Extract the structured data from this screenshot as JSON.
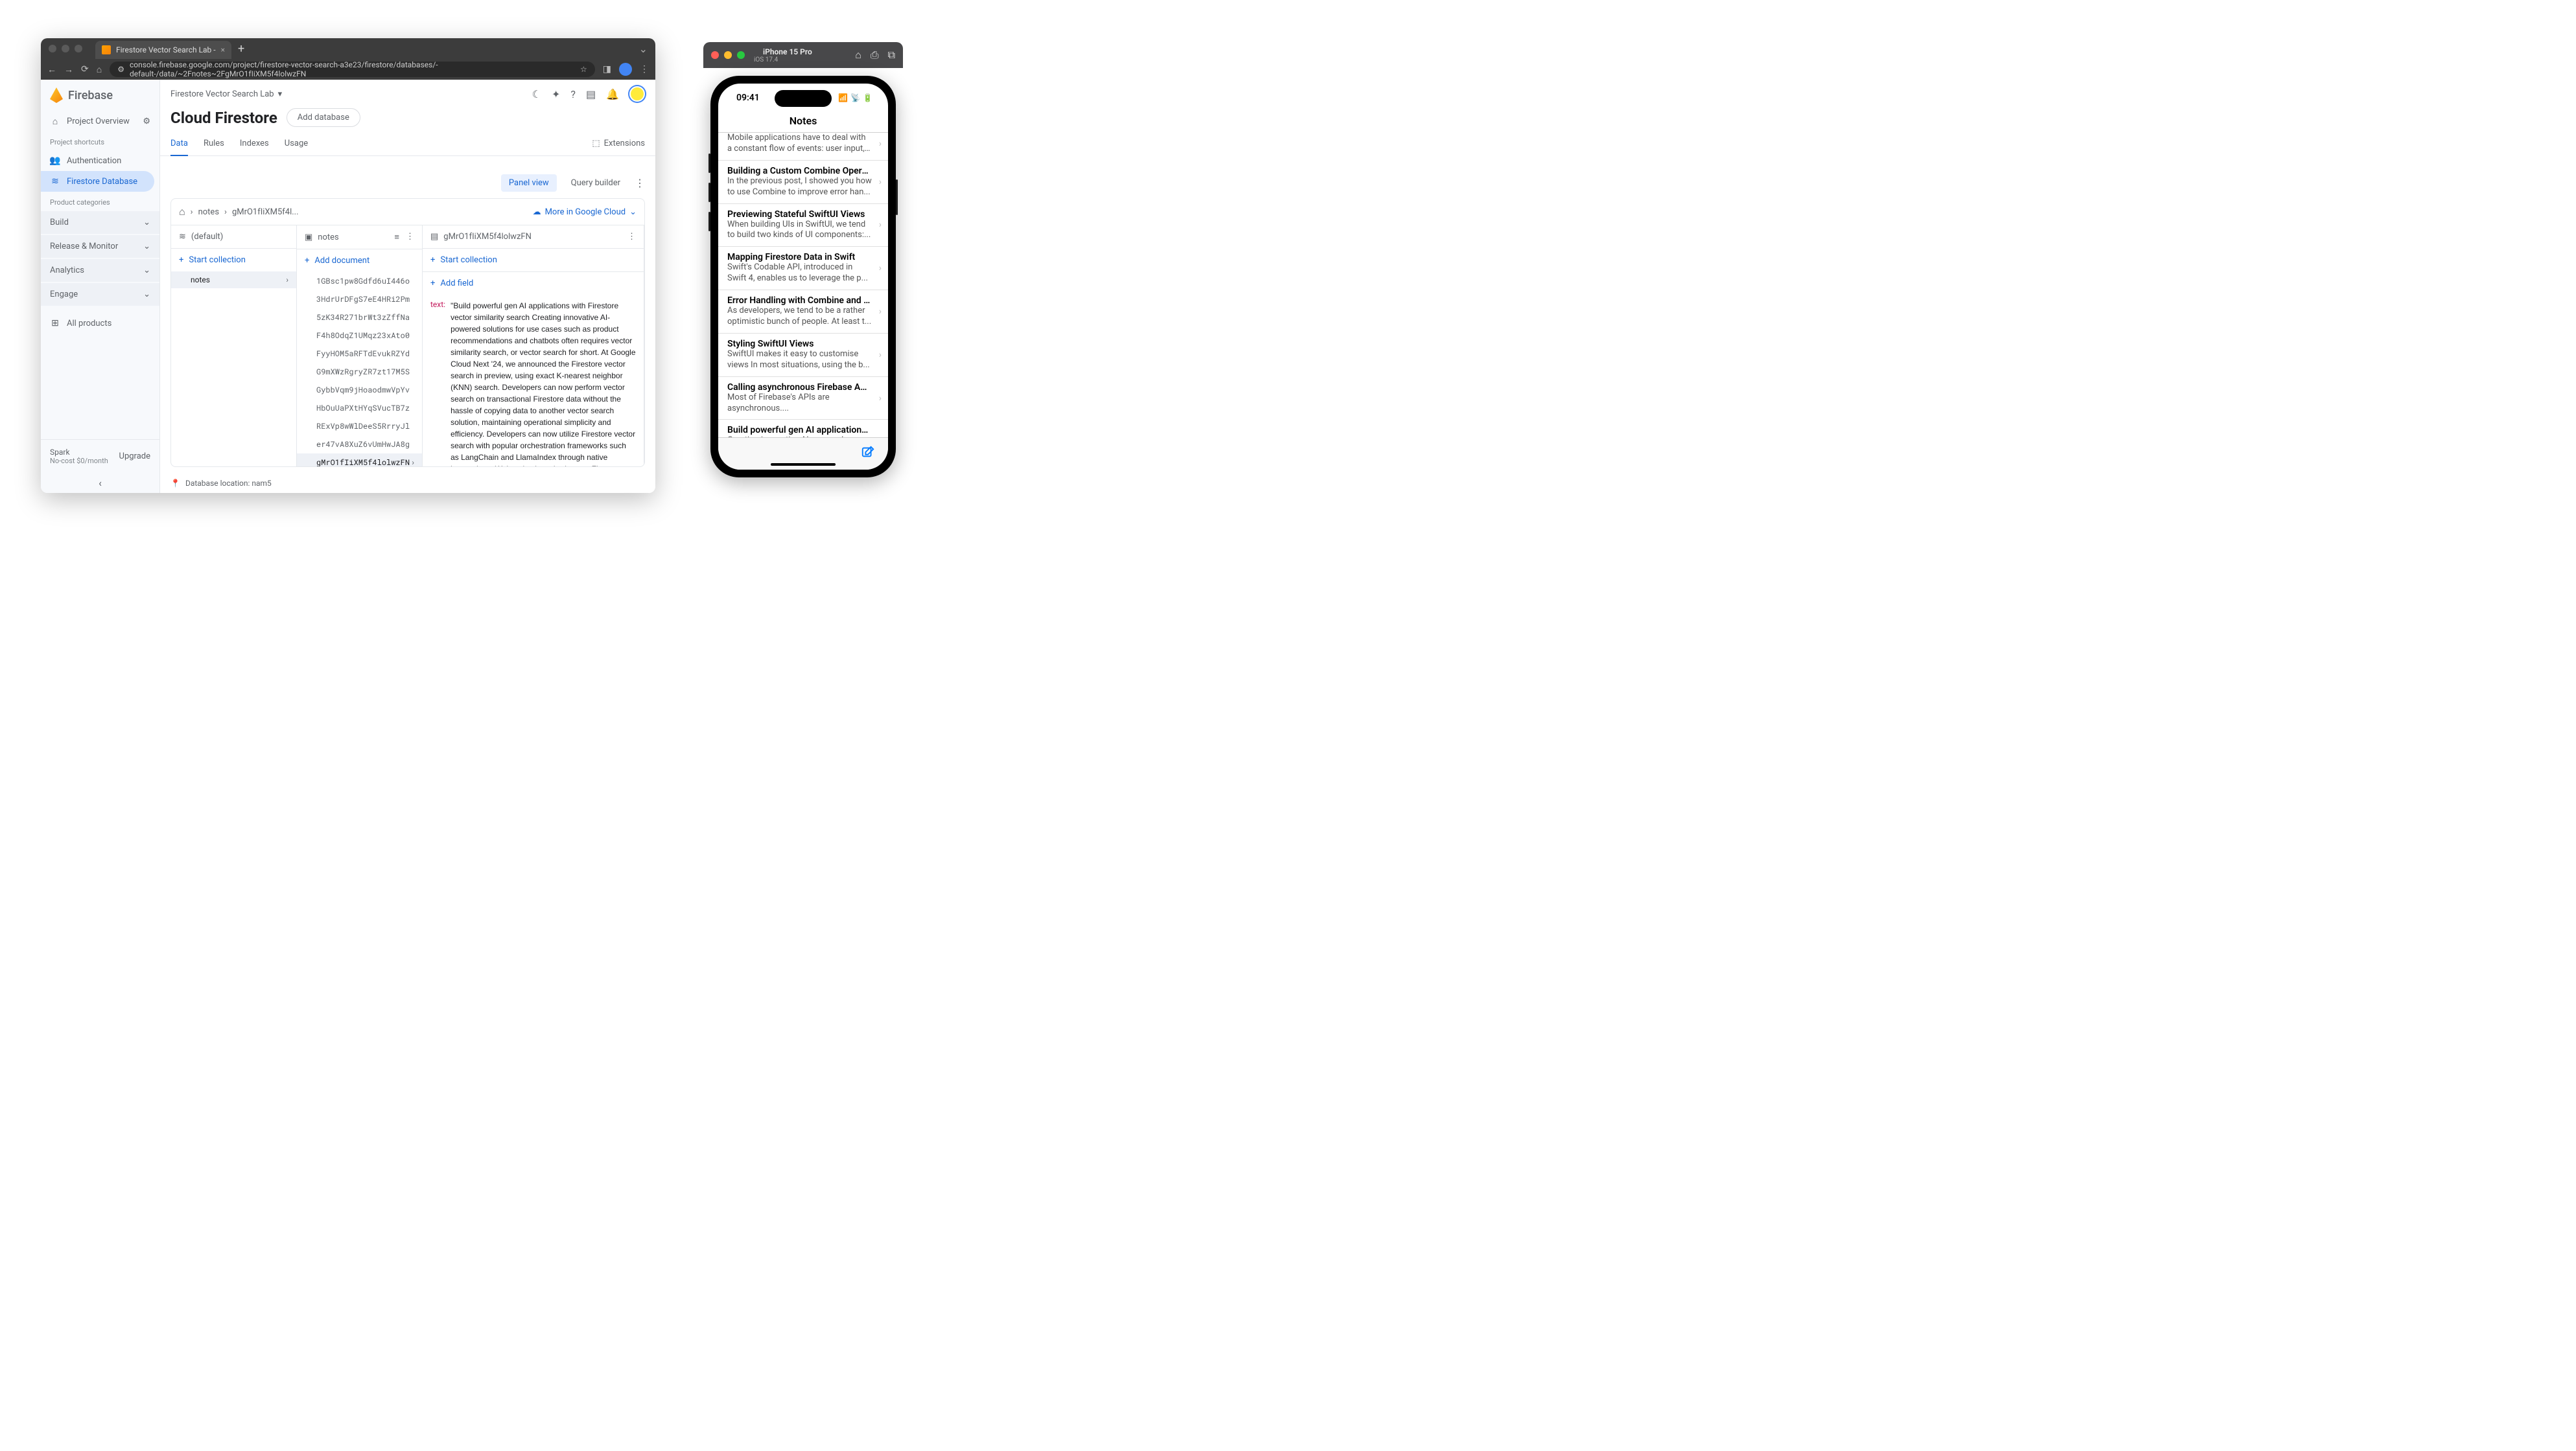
{
  "browser": {
    "tab_title": "Firestore Vector Search Lab - ",
    "url": "console.firebase.google.com/project/firestore-vector-search-a3e23/firestore/databases/-default-/data/~2Fnotes~2FgMrO1fIiXM5f4lolwzFN"
  },
  "firebase": {
    "logo": "Firebase",
    "overview": "Project Overview",
    "shortcuts_label": "Project shortcuts",
    "shortcuts": [
      "Authentication",
      "Firestore Database"
    ],
    "categories_label": "Product categories",
    "categories": [
      "Build",
      "Release & Monitor",
      "Analytics",
      "Engage"
    ],
    "all_products": "All products",
    "spark": "Spark",
    "spark_sub": "No-cost $0/month",
    "upgrade": "Upgrade",
    "project": "Firestore Vector Search Lab",
    "title": "Cloud Firestore",
    "add_db": "Add database",
    "tabs": [
      "Data",
      "Rules",
      "Indexes",
      "Usage"
    ],
    "extensions": "Extensions",
    "panel_view": "Panel view",
    "query_builder": "Query builder",
    "breadcrumb": {
      "coll": "notes",
      "doc": "gMrO1fIiXM5f4l..."
    },
    "more_cloud": "More in Google Cloud",
    "p1_head": "(default)",
    "p2_head": "notes",
    "p3_head": "gMrO1fIiXM5f4lolwzFN",
    "start_collection": "Start collection",
    "add_document": "Add document",
    "add_field": "Add field",
    "collections": [
      "notes"
    ],
    "docs": [
      "1GBsc1pw8Gdfd6uI446o",
      "3HdrUrDFgS7eE4HRi2Pm",
      "5zK34R271brWt3zZffNa",
      "F4h8OdqZ1UMqz23xAto0",
      "FyyHOM5aRFTdEvukRZYd",
      "G9mXWzRgryZR7zt17M5S",
      "GybbVqm9jHoaodmwVpYv",
      "HbOuUaPXtHYqSVucTB7z",
      "RExVp8wWlDeeS5RrryJl",
      "er47vA8XuZ6vUmHwJA8g",
      "gMrO1fIiXM5f4lolwzFN"
    ],
    "field_key": "text:",
    "field_val": "\"Build powerful gen AI applications with Firestore vector similarity search Creating innovative AI-powered solutions for use cases such as product recommendations and chatbots often requires vector similarity search, or vector search for short. At Google Cloud Next '24, we announced the Firestore vector search in preview, using exact K-nearest neighbor (KNN) search. Developers can now perform vector search on transactional Firestore data without the hassle of copying data to another vector search solution, maintaining operational simplicity and efficiency. Developers can now utilize Firestore vector search with popular orchestration frameworks such as LangChain and LlamaIndex through native integrations. We've also launched a new Firestore extension to make it easier for you to automatically compute vector embeddings on your data, and create web services that make it easier for you to perform vector searches from a web or mobile application. In this blog, we'll discuss how developers can get started with Firestore's new vector search",
    "db_location": "Database location: nam5"
  },
  "simulator": {
    "device": "iPhone 15 Pro",
    "os": "iOS 17.4",
    "time": "09:41",
    "nav_title": "Notes",
    "notes": [
      {
        "title": "",
        "preview": "Mobile applications have to deal with a constant flow of events: user input, n..."
      },
      {
        "title": "Building a Custom Combine Operat...",
        "preview": "In the previous post, I showed you how to use Combine to improve error han..."
      },
      {
        "title": "Previewing Stateful SwiftUI Views",
        "preview": "When building UIs in SwiftUI, we tend to build two kinds of UI components:..."
      },
      {
        "title": "Mapping Firestore Data in Swift",
        "preview": "Swift's Codable API, introduced in Swift 4, enables us to leverage the p..."
      },
      {
        "title": "Error Handling with Combine and S...",
        "preview": "As developers, we tend to be a rather optimistic bunch of people. At least t..."
      },
      {
        "title": "Styling SwiftUI Views",
        "preview": "SwiftUI makes it easy to customise views In most situations, using the b..."
      },
      {
        "title": "Calling asynchronous Firebase API...",
        "preview": "Most of Firebase's APIs are asynchronous...."
      },
      {
        "title": "Build powerful gen AI applications...",
        "preview": "Creating innovative AI-powered solutions for use cases such as prod..."
      }
    ]
  }
}
